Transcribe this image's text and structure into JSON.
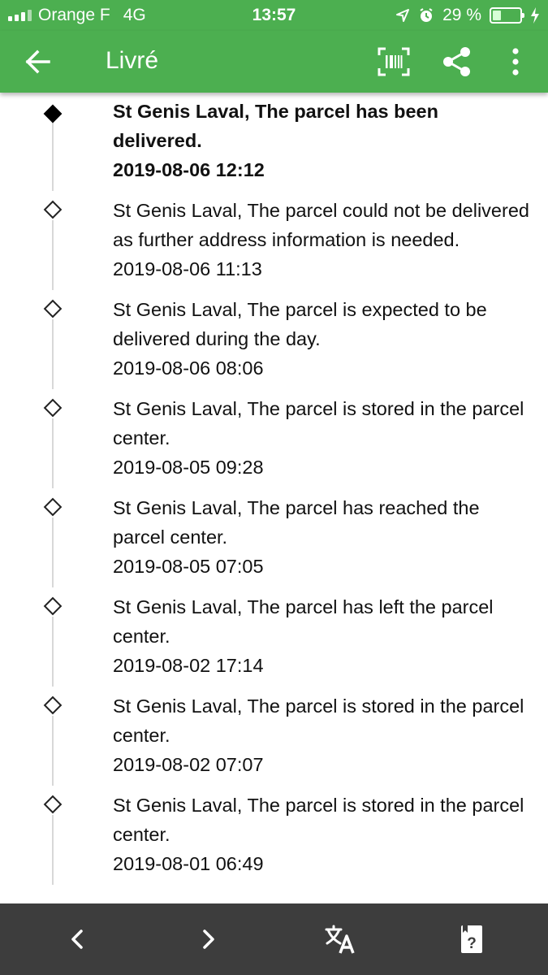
{
  "status_bar": {
    "carrier": "Orange F",
    "network": "4G",
    "time": "13:57",
    "battery_percent": "29 %",
    "battery_level": 0.29
  },
  "app_bar": {
    "title": "Livré",
    "icons": [
      "arrow-back-icon",
      "barcode-scan-icon",
      "share-icon",
      "more-vert-icon"
    ]
  },
  "events": [
    {
      "text": "St Genis Laval, The parcel has been delivered.",
      "date": "2019-08-06 12:12"
    },
    {
      "text": "St Genis Laval, The parcel could not be delivered as further address information is needed.",
      "date": "2019-08-06 11:13"
    },
    {
      "text": "St Genis Laval, The parcel is expected to be delivered during the day.",
      "date": "2019-08-06 08:06"
    },
    {
      "text": "St Genis Laval, The parcel is stored in the parcel center.",
      "date": "2019-08-05 09:28"
    },
    {
      "text": "St Genis Laval, The parcel has reached the parcel center.",
      "date": "2019-08-05 07:05"
    },
    {
      "text": "St Genis Laval, The parcel has left the parcel center.",
      "date": "2019-08-02 17:14"
    },
    {
      "text": "St Genis Laval, The parcel is stored in the parcel center.",
      "date": "2019-08-02 07:07"
    },
    {
      "text": "St Genis Laval, The parcel is stored in the parcel center.",
      "date": "2019-08-01 06:49"
    }
  ],
  "bottom_bar": {
    "icons": [
      "chevron-left-icon",
      "chevron-right-icon",
      "translate-icon",
      "help-card-icon"
    ],
    "help_glyph": "?"
  },
  "colors": {
    "primary": "#4caf50",
    "bottom_bar": "#3d3d3d"
  }
}
